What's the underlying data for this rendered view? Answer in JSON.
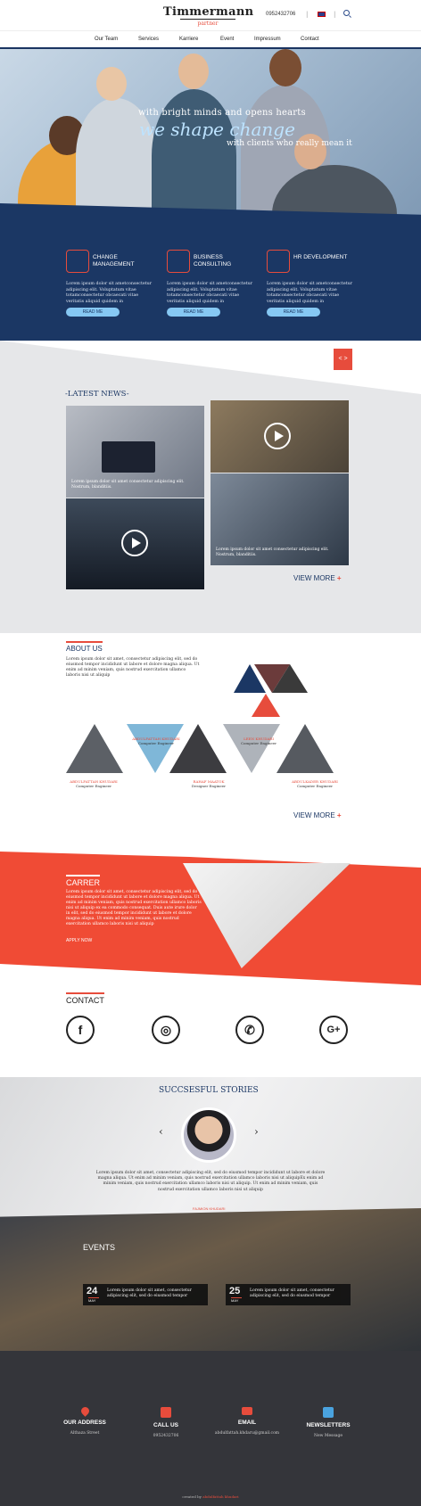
{
  "header": {
    "logo": "Timmermann",
    "logo_sub": "partner",
    "phone": "0952432706",
    "nav": [
      "Our Team",
      "Services",
      "Karriere",
      "Event",
      "Impressum",
      "Contact"
    ]
  },
  "hero": {
    "line1": "with bright minds and opens hearts",
    "line2": "we shape change",
    "line3": "with clients who really mean it"
  },
  "services": [
    {
      "title": "CHANGE MANAGEMENT",
      "text": "Lorem ipsum dolor sit ametconsectetur adipiscing elit. Voluptatum vitae totamconsectetur obcaecati vitae veritatis aliquid quidem in",
      "button": "READ ME",
      "icon": "gear-brain-icon"
    },
    {
      "title": "BUSINESS CONSULTING",
      "text": "Lorem ipsum dolor sit ametconsectetur adipiscing elit. Voluptatum vitae totamconsectetur obcaecati vitae veritatis aliquid quidem in",
      "button": "READ ME",
      "icon": "meeting-icon"
    },
    {
      "title": "HR DEVELOPMENT",
      "text": "Lorem ipsum dolor sit ametconsectetur adipiscing elit. Voluptatum vitae totamconsectetur obcaecati vitae veritatis aliquid quidem in",
      "button": "READ ME",
      "icon": "people-chat-icon"
    }
  ],
  "news": {
    "arrows": "< >",
    "title": "-LATEST NEWS-",
    "cards": [
      {
        "caption": "Lorem ipsum dolor sit amet consectetur adipiscing elit. Nostrum, blanditiis."
      },
      {
        "caption": ""
      },
      {
        "caption": ""
      },
      {
        "caption": "Lorem ipsum dolor sit amet consectetur adipiscing elit. Nostrum, blanditiis."
      }
    ],
    "view_more": "VIEW MORE",
    "plus": "+"
  },
  "about": {
    "title": "ABOUT US",
    "text": "Lorem ipsum dolor sit amet, consectetur adipiscing elit, sed do eiusmod tempor incididunt ut labore et dolore magna aliqua. Ut enim ad minim veniam, quis nostrud exercitation ullamco laboris nisi ut aliquip",
    "team": [
      {
        "name": "ABDULFATTAH KHUDARI",
        "role": "Computer Engineer"
      },
      {
        "name": "ABDULFATTAH KHUDARI",
        "role": "Computer Engineer"
      },
      {
        "name": "RAHAF MAATOK",
        "role": "Designer Engineer"
      },
      {
        "name": "LEEN KHUDARI",
        "role": "Computer Engineer"
      },
      {
        "name": "ABDULKADER KHUDARI",
        "role": "Computer Engineer"
      }
    ],
    "view_more": "VIEW MORE",
    "plus": "+"
  },
  "career": {
    "title": "CARRER",
    "text": "Lorem ipsum dolor sit amet, consectetur adipiscing elit, sed do eiusmod tempor incididunt ut labore et dolore magna aliqua. Ut enim ad minim veniam, quis nostrud exercitation ullamco laboris nisi ut aliquip ex ea commodo consequat. Duis aute irure dolor in elit, sed do eiusmod tempor incididunt ut labore et dolore magna aliqua. Ut enim ad minim veniam, quis nostrud exercitation ullamco laboris nisi ut aliquip",
    "apply": "APPLY NOW"
  },
  "contact": {
    "title": "CONTACT",
    "icons": [
      {
        "glyph": "f",
        "name": "facebook-icon"
      },
      {
        "glyph": "◎",
        "name": "instagram-icon"
      },
      {
        "glyph": "✆",
        "name": "whatsapp-icon"
      },
      {
        "glyph": "G+",
        "name": "google-plus-icon"
      }
    ]
  },
  "stories": {
    "title": "SUCCSESFUL STORIES",
    "prev": "‹",
    "next": "›",
    "text": "Lorem ipsum dolor sit amet, consectetur adipiscing elit, sed do eiusmod tempor incididunt ut labore et dolore magna aliqua. Ut enim ad minim veniam, quis nostrud exercitation ullamco laboris nisi ut aliquipEx enim ad minim veniam, quis nostrud exercitation ullamco laboris nisi ut aliquip. Ut enim ad minim veniam, quis nostrud exercitation ullamco laboris nisi ut aliquip",
    "name": "FAJMION KHUDARI"
  },
  "events": {
    "title": "EVENTS",
    "items": [
      {
        "day": "24",
        "month": "MAY",
        "text": "Lorem ipsum dolor sit amet, consectetur adipiscing elit, sed do eiusmod tempor"
      },
      {
        "day": "25",
        "month": "MAY",
        "text": "Lorem ipsum dolor sit amet, consectetur adipiscing elit, sed do eiusmod tempor"
      }
    ]
  },
  "footer": {
    "columns": [
      {
        "head": "OUR ADDRESS",
        "value": "Althaza Street",
        "icon": "location-pin-icon"
      },
      {
        "head": "CALL US",
        "value": "0952432706",
        "icon": "phone-icon"
      },
      {
        "head": "EMAIL",
        "value": "abdulfattah.khdaru@gmail.com",
        "icon": "mail-icon"
      },
      {
        "head": "NEWSLETTERS",
        "value": "New Message",
        "icon": "chat-icon"
      }
    ],
    "copy_prefix": "created by",
    "copy_name": "abdulfattah khudari"
  },
  "colors": {
    "navy": "#1b3764",
    "red": "#e74c3c",
    "light_blue": "#86c8f3",
    "footer": "#34353a"
  }
}
